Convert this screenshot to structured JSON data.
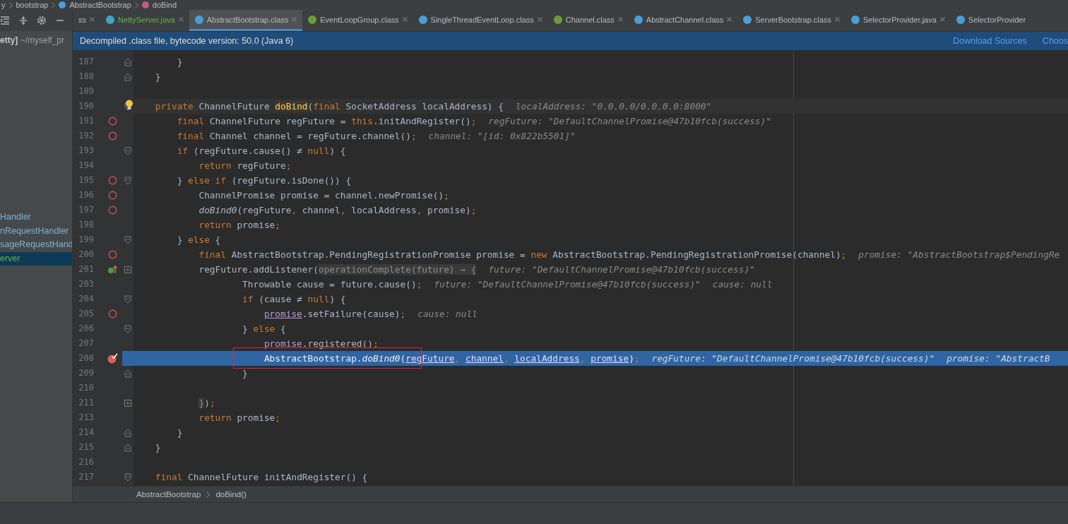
{
  "breadcrumb_top": [
    {
      "label": "y"
    },
    {
      "label": "bootstrap"
    },
    {
      "label": "AbstractBootstrap",
      "kind": "class"
    },
    {
      "label": "doBind",
      "kind": "method"
    }
  ],
  "project": {
    "path_bold": "etty]",
    "path": "~/myself_pr"
  },
  "tree": [
    {
      "label": "Handler",
      "selected": false
    },
    {
      "label": "nRequestHandler",
      "selected": false
    },
    {
      "label": "sageRequestHand",
      "selected": false
    },
    {
      "label": "erver",
      "selected": true
    }
  ],
  "tabs": [
    {
      "label": "ss",
      "selected": false,
      "modified": false
    },
    {
      "label": "NettyServer.java",
      "kind": "java",
      "selected": false,
      "modified": true
    },
    {
      "label": "AbstractBootstrap.class",
      "kind": "class",
      "selected": true,
      "modified": false
    },
    {
      "label": "EventLoopGroup.class",
      "kind": "interface",
      "selected": false,
      "modified": false
    },
    {
      "label": "SingleThreadEventLoop.class",
      "kind": "class",
      "selected": false,
      "modified": false
    },
    {
      "label": "Channel.class",
      "kind": "interface",
      "selected": false,
      "modified": false
    },
    {
      "label": "AbstractChannel.class",
      "kind": "class",
      "selected": false,
      "modified": false
    },
    {
      "label": "ServerBootstrap.class",
      "kind": "class",
      "selected": false,
      "modified": false
    },
    {
      "label": "SelectorProvider.java",
      "kind": "class",
      "selected": false,
      "modified": false
    },
    {
      "label": "SelectorProvider",
      "kind": "class",
      "selected": false,
      "modified": false
    }
  ],
  "banner": {
    "message": "Decompiled .class file, bytecode version: 50.0 (Java 6)",
    "links": [
      "Download Sources",
      "Choos"
    ]
  },
  "lines": [
    {
      "number": "187",
      "fold": {
        "kind": "end"
      },
      "current": false,
      "executing": false,
      "code": [
        {
          "kind": "t",
          "s": "        }"
        }
      ]
    },
    {
      "number": "188",
      "fold": {
        "kind": "end"
      },
      "current": false,
      "executing": false,
      "code": [
        {
          "kind": "t",
          "s": "    }"
        }
      ]
    },
    {
      "number": "189",
      "current": false,
      "executing": false
    },
    {
      "number": "190",
      "fold": {
        "kind": "start"
      },
      "marker": {
        "kind": "bulb"
      },
      "current": true,
      "executing": false,
      "code": [
        {
          "kind": "kw",
          "s": "    private "
        },
        {
          "kind": "t",
          "s": "ChannelFuture "
        },
        {
          "kind": "dm",
          "s": "doBind"
        },
        {
          "kind": "t",
          "s": "("
        },
        {
          "kind": "kw",
          "s": "final "
        },
        {
          "kind": "t",
          "s": "SocketAddress localAddress) {"
        }
      ],
      "hints": [
        "localAddress: \"0.0.0.0/0.0.0.0:8000\""
      ]
    },
    {
      "number": "191",
      "breakpoint": {
        "kind": "line"
      },
      "current": false,
      "executing": false,
      "code": [
        {
          "kind": "kw",
          "s": "        final "
        },
        {
          "kind": "t",
          "s": "ChannelFuture regFuture = "
        },
        {
          "kind": "kw",
          "s": "this"
        },
        {
          "kind": "t",
          "s": ".initAndRegister()"
        },
        {
          "kind": "pun",
          "s": ";"
        }
      ],
      "hints": [
        "regFuture: \"DefaultChannelPromise@47b10fcb(success)\""
      ]
    },
    {
      "number": "192",
      "breakpoint": {
        "kind": "line"
      },
      "current": false,
      "executing": false,
      "code": [
        {
          "kind": "kw",
          "s": "        final "
        },
        {
          "kind": "t",
          "s": "Channel channel = regFuture.channel()"
        },
        {
          "kind": "pun",
          "s": ";"
        }
      ],
      "hints": [
        "channel: \"[id: 0x822b5501]\""
      ]
    },
    {
      "number": "193",
      "fold": {
        "kind": "start"
      },
      "current": false,
      "executing": false,
      "code": [
        {
          "kind": "kw",
          "s": "        if "
        },
        {
          "kind": "t",
          "s": "(regFuture.cause() ≠ "
        },
        {
          "kind": "kw",
          "s": "null"
        },
        {
          "kind": "t",
          "s": ") {"
        }
      ]
    },
    {
      "number": "194",
      "current": false,
      "executing": false,
      "code": [
        {
          "kind": "kw",
          "s": "            return "
        },
        {
          "kind": "t",
          "s": "regFuture"
        },
        {
          "kind": "pun",
          "s": ";"
        }
      ]
    },
    {
      "number": "195",
      "breakpoint": {
        "kind": "line"
      },
      "fold": {
        "kind": "start"
      },
      "current": false,
      "executing": false,
      "code": [
        {
          "kind": "t",
          "s": "        } "
        },
        {
          "kind": "kw",
          "s": "else if "
        },
        {
          "kind": "t",
          "s": "(regFuture.isDone()) {"
        }
      ]
    },
    {
      "number": "196",
      "breakpoint": {
        "kind": "line"
      },
      "current": false,
      "executing": false,
      "code": [
        {
          "kind": "t",
          "s": "            ChannelPromise promise = channel.newPromise()"
        },
        {
          "kind": "pun",
          "s": ";"
        }
      ]
    },
    {
      "number": "197",
      "breakpoint": {
        "kind": "line"
      },
      "current": false,
      "executing": false,
      "code": [
        {
          "kind": "it",
          "s": "            doBind0"
        },
        {
          "kind": "t",
          "s": "(regFuture"
        },
        {
          "kind": "pun",
          "s": ", "
        },
        {
          "kind": "t",
          "s": "channel"
        },
        {
          "kind": "pun",
          "s": ", "
        },
        {
          "kind": "t",
          "s": "localAddress"
        },
        {
          "kind": "pun",
          "s": ", "
        },
        {
          "kind": "t",
          "s": "promise)"
        },
        {
          "kind": "pun",
          "s": ";"
        }
      ]
    },
    {
      "number": "198",
      "current": false,
      "executing": false,
      "code": [
        {
          "kind": "kw",
          "s": "            return "
        },
        {
          "kind": "t",
          "s": "promise"
        },
        {
          "kind": "pun",
          "s": ";"
        }
      ]
    },
    {
      "number": "199",
      "fold": {
        "kind": "start"
      },
      "current": false,
      "executing": false,
      "code": [
        {
          "kind": "t",
          "s": "        } "
        },
        {
          "kind": "kw",
          "s": "else "
        },
        {
          "kind": "t",
          "s": "{"
        }
      ]
    },
    {
      "number": "200",
      "breakpoint": {
        "kind": "line"
      },
      "current": false,
      "executing": false,
      "code": [
        {
          "kind": "kw",
          "s": "            final "
        },
        {
          "kind": "t",
          "s": "AbstractBootstrap.PendingRegistrationPromise promise = "
        },
        {
          "kind": "kw",
          "s": "new "
        },
        {
          "kind": "t",
          "s": "AbstractBootstrap.PendingRegistrationPromise(channel)"
        },
        {
          "kind": "pun",
          "s": ";"
        }
      ],
      "hints": [
        "promise: \"AbstractBootstrap$PendingRe"
      ]
    },
    {
      "number": "201",
      "breakpoint": {
        "kind": "lambda"
      },
      "fold": {
        "kind": "collapsed"
      },
      "current": false,
      "executing": false,
      "code": [
        {
          "kind": "t",
          "s": "            regFuture.addListener("
        },
        {
          "kind": "fold",
          "s": "operationComplete(future) → {"
        }
      ],
      "hints": [
        "future: \"DefaultChannelPromise@47b10fcb(success)\""
      ]
    },
    {
      "number": "203",
      "current": false,
      "executing": false,
      "code": [
        {
          "kind": "t",
          "s": "                    Throwable cause = future.cause()"
        },
        {
          "kind": "pun",
          "s": ";"
        }
      ],
      "hints": [
        "future: \"DefaultChannelPromise@47b10fcb(success)\"",
        "cause: null"
      ]
    },
    {
      "number": "204",
      "fold": {
        "kind": "start"
      },
      "current": false,
      "executing": false,
      "code": [
        {
          "kind": "kw",
          "s": "                    if "
        },
        {
          "kind": "t",
          "s": "(cause ≠ "
        },
        {
          "kind": "kw",
          "s": "null"
        },
        {
          "kind": "t",
          "s": ") {"
        }
      ]
    },
    {
      "number": "205",
      "breakpoint": {
        "kind": "line"
      },
      "current": false,
      "executing": false,
      "code": [
        {
          "kind": "ref",
          "s": "                        promise"
        },
        {
          "kind": "t",
          "s": ".setFailure(cause)"
        },
        {
          "kind": "pun",
          "s": ";"
        }
      ],
      "hints": [
        "cause: null"
      ]
    },
    {
      "number": "206",
      "fold": {
        "kind": "start"
      },
      "current": false,
      "executing": false,
      "code": [
        {
          "kind": "t",
          "s": "                    } "
        },
        {
          "kind": "kw",
          "s": "else "
        },
        {
          "kind": "t",
          "s": "{"
        }
      ]
    },
    {
      "number": "207",
      "current": false,
      "executing": false,
      "code": [
        {
          "kind": "ref",
          "s": "                        promise"
        },
        {
          "kind": "t",
          "s": ".registered()"
        },
        {
          "kind": "pun",
          "s": ";"
        }
      ]
    },
    {
      "number": "208",
      "breakpoint": {
        "kind": "hit"
      },
      "current": false,
      "executing": true,
      "annotated": true,
      "code": [
        {
          "kind": "t",
          "s": "                        AbstractBootstrap."
        },
        {
          "kind": "it",
          "s": "doBind0"
        },
        {
          "kind": "t",
          "s": "("
        },
        {
          "kind": "ref",
          "s": "regFuture"
        },
        {
          "kind": "pun",
          "s": ", "
        },
        {
          "kind": "ref",
          "s": "channel"
        },
        {
          "kind": "pun",
          "s": ", "
        },
        {
          "kind": "ref",
          "s": "localAddress"
        },
        {
          "kind": "pun",
          "s": ", "
        },
        {
          "kind": "ref",
          "s": "promise"
        },
        {
          "kind": "t",
          "s": ")"
        },
        {
          "kind": "pun",
          "s": ";"
        }
      ],
      "hints": [
        "regFuture: \"DefaultChannelPromise@47b10fcb(success)\"",
        "promise: \"AbstractB"
      ]
    },
    {
      "number": "209",
      "fold": {
        "kind": "end"
      },
      "current": false,
      "executing": false,
      "code": [
        {
          "kind": "t",
          "s": "                    }"
        }
      ]
    },
    {
      "number": "210",
      "current": false,
      "executing": false
    },
    {
      "number": "211",
      "fold": {
        "kind": "collapsed"
      },
      "current": false,
      "executing": false,
      "code": [
        {
          "kind": "fold",
          "s": "            }"
        },
        {
          "kind": "t",
          "s": ")"
        },
        {
          "kind": "pun",
          "s": ";"
        }
      ]
    },
    {
      "number": "213",
      "current": false,
      "executing": false,
      "code": [
        {
          "kind": "kw",
          "s": "            return "
        },
        {
          "kind": "t",
          "s": "promise"
        },
        {
          "kind": "pun",
          "s": ";"
        }
      ]
    },
    {
      "number": "214",
      "fold": {
        "kind": "end"
      },
      "current": false,
      "executing": false,
      "code": [
        {
          "kind": "t",
          "s": "        }"
        }
      ]
    },
    {
      "number": "215",
      "fold": {
        "kind": "end"
      },
      "current": false,
      "executing": false,
      "code": [
        {
          "kind": "t",
          "s": "    }"
        }
      ]
    },
    {
      "number": "216",
      "current": false,
      "executing": false
    },
    {
      "number": "217",
      "fold": {
        "kind": "start"
      },
      "current": false,
      "executing": false,
      "code": [
        {
          "kind": "kw",
          "s": "    final "
        },
        {
          "kind": "t",
          "s": "ChannelFuture initAndRegister() {"
        }
      ]
    }
  ],
  "breadcrumb_bottom": [
    "AbstractBootstrap",
    "doBind()"
  ]
}
